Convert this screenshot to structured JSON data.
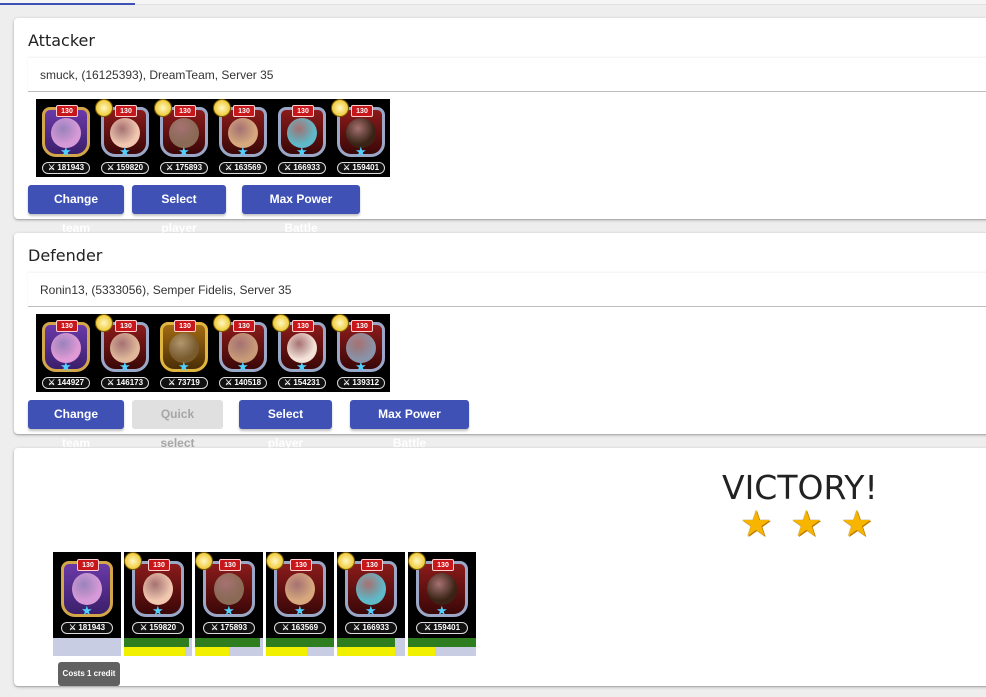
{
  "attacker": {
    "title": "Attacker",
    "player": "smuck, (16125393), DreamTeam, Server 35",
    "heroes": [
      {
        "level": "130",
        "power": "181943",
        "face": "#d79ad8",
        "style": "purple",
        "badge": false
      },
      {
        "level": "130",
        "power": "159820",
        "face": "#f1c7b0",
        "style": "",
        "badge": true
      },
      {
        "level": "130",
        "power": "175893",
        "face": "#8a6a55",
        "style": "",
        "badge": true
      },
      {
        "level": "130",
        "power": "163569",
        "face": "#d7a87e",
        "style": "",
        "badge": true
      },
      {
        "level": "130",
        "power": "166933",
        "face": "#5fb9c9",
        "style": "",
        "badge": false
      },
      {
        "level": "130",
        "power": "159401",
        "face": "#3a2315",
        "style": "",
        "badge": true
      }
    ],
    "buttons": {
      "change_team": "Change team",
      "select_player": "Select player",
      "max_power": "Max Power Battle"
    }
  },
  "defender": {
    "title": "Defender",
    "player": "Ronin13, (5333056), Semper Fidelis, Server 35",
    "heroes": [
      {
        "level": "130",
        "power": "144927",
        "face": "#e09ad6",
        "style": "purple",
        "badge": false
      },
      {
        "level": "130",
        "power": "146173",
        "face": "#e0b79a",
        "style": "",
        "badge": true
      },
      {
        "level": "130",
        "power": "73719",
        "face": "#7a5b2e",
        "style": "gold",
        "badge": false
      },
      {
        "level": "130",
        "power": "140518",
        "face": "#c89a78",
        "style": "",
        "badge": true
      },
      {
        "level": "130",
        "power": "154231",
        "face": "#f4e2d8",
        "style": "",
        "badge": true
      },
      {
        "level": "130",
        "power": "139312",
        "face": "#8b93a8",
        "style": "",
        "badge": true
      }
    ],
    "buttons": {
      "change_team": "Change team",
      "quick_select": "Quick select",
      "select_player": "Select player",
      "max_power": "Max Power Battle"
    }
  },
  "result": {
    "outcome": "VICTORY!",
    "stars": [
      "★",
      "★",
      "★"
    ],
    "heroes": [
      {
        "level": "130",
        "power": "181943",
        "face": "#d79ad8",
        "style": "purple",
        "hp": 0,
        "energy": 0
      },
      {
        "level": "130",
        "power": "159820",
        "face": "#f1c7b0",
        "style": "",
        "hp": 0.95,
        "energy": 0.9
      },
      {
        "level": "130",
        "power": "175893",
        "face": "#8a6a55",
        "style": "",
        "hp": 0.95,
        "energy": 0.5
      },
      {
        "level": "130",
        "power": "163569",
        "face": "#d7a87e",
        "style": "",
        "hp": 1.0,
        "energy": 0.6
      },
      {
        "level": "130",
        "power": "166933",
        "face": "#5fb9c9",
        "style": "",
        "hp": 0.85,
        "energy": 0.85
      },
      {
        "level": "130",
        "power": "159401",
        "face": "#3a2315",
        "style": "",
        "hp": 1.0,
        "energy": 0.4
      }
    ],
    "cost_label": "Costs 1 credit"
  },
  "colors": {
    "primary": "#3f51b5",
    "disabled_bg": "#e0e0e0",
    "hp": "#2e7d1f",
    "energy": "#f0f000"
  }
}
